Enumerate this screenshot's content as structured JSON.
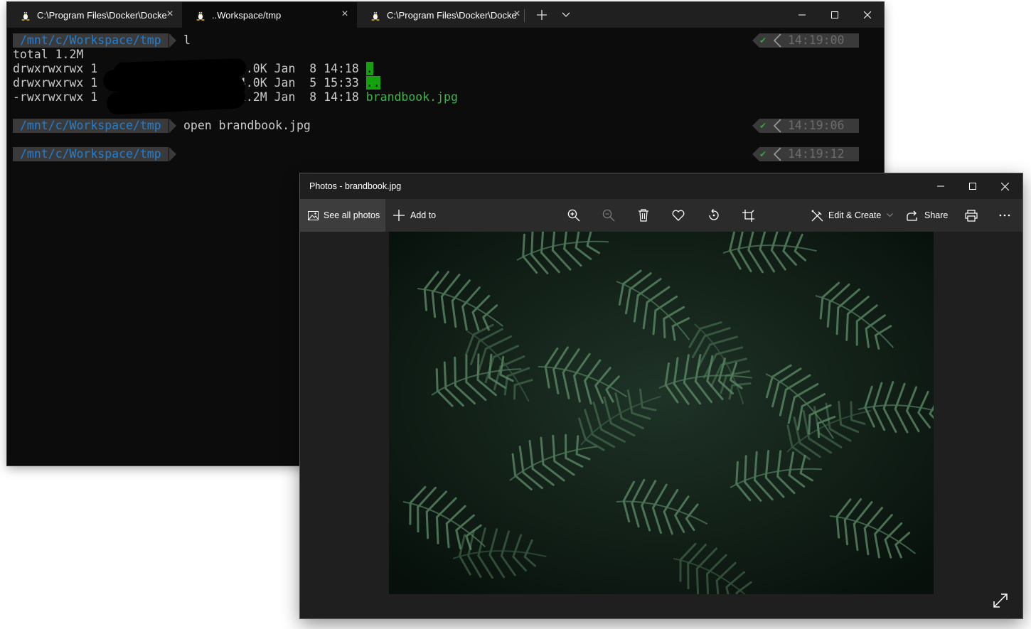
{
  "terminal": {
    "tabs": [
      {
        "label": "C:\\Program Files\\Docker\\Docke",
        "active": false
      },
      {
        "label": "..Workspace/tmp",
        "active": true
      },
      {
        "label": "C:\\Program Files\\Docker\\Docke",
        "active": false
      }
    ],
    "prompt_path": "/mnt/c/Workspace/tmp",
    "blocks": [
      {
        "command": "l",
        "time": "14:19:00",
        "output": {
          "total": "total 1.2M",
          "rows": [
            {
              "perm": "drwxrwxrwx 1",
              "size": "4.0K",
              "month": "Jan",
              "day": " 8",
              "clock": "14:18",
              "name": "."
            },
            {
              "perm": "drwxrwxrwx 1",
              "size": "4.0K",
              "month": "Jan",
              "day": " 5",
              "clock": "15:33",
              "name": ".."
            },
            {
              "perm": "-rwxrwxrwx 1",
              "size": "1.2M",
              "month": "Jan",
              "day": " 8",
              "clock": "14:18",
              "name": "brandbook.jpg"
            }
          ]
        }
      },
      {
        "command": "open brandbook.jpg",
        "time": "14:19:06"
      },
      {
        "command": "",
        "time": "14:19:12"
      }
    ],
    "colors": {
      "background": "#0c0c0c",
      "path": "#1e7fd8",
      "segment": "#3a3a3a",
      "file_green": "#3fb64a",
      "dir_highlight": "#13a10e"
    }
  },
  "photos": {
    "title": "Photos - brandbook.jpg",
    "toolbar": {
      "see_all": "See all photos",
      "add_to": "Add to",
      "edit_create": "Edit & Create",
      "share": "Share"
    },
    "icons": [
      "gallery-icon",
      "plus-icon",
      "zoom-in-icon",
      "zoom-out-icon",
      "delete-icon",
      "heart-icon",
      "rotate-icon",
      "crop-icon",
      "edit-icon",
      "share-icon",
      "print-icon",
      "more-icon",
      "expand-icon"
    ]
  }
}
